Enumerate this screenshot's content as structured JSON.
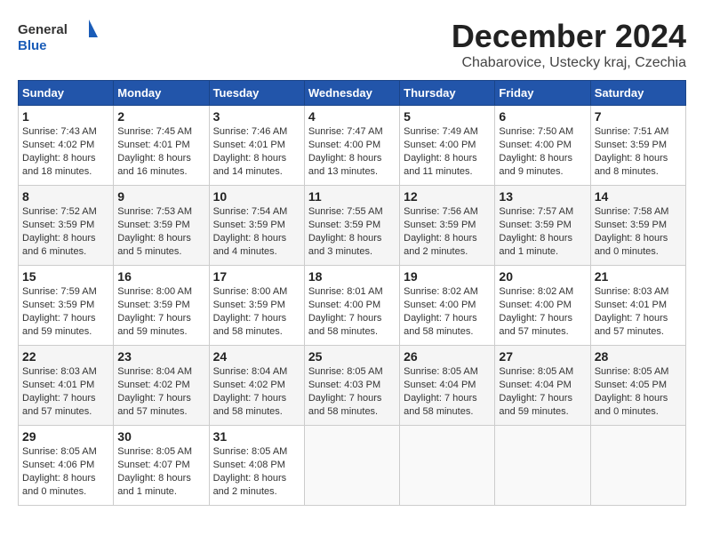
{
  "header": {
    "logo_general": "General",
    "logo_blue": "Blue",
    "month_title": "December 2024",
    "location": "Chabarovice, Ustecky kraj, Czechia"
  },
  "weekdays": [
    "Sunday",
    "Monday",
    "Tuesday",
    "Wednesday",
    "Thursday",
    "Friday",
    "Saturday"
  ],
  "weeks": [
    [
      {
        "day": "1",
        "sunrise": "7:43 AM",
        "sunset": "4:02 PM",
        "daylight": "8 hours and 18 minutes."
      },
      {
        "day": "2",
        "sunrise": "7:45 AM",
        "sunset": "4:01 PM",
        "daylight": "8 hours and 16 minutes."
      },
      {
        "day": "3",
        "sunrise": "7:46 AM",
        "sunset": "4:01 PM",
        "daylight": "8 hours and 14 minutes."
      },
      {
        "day": "4",
        "sunrise": "7:47 AM",
        "sunset": "4:00 PM",
        "daylight": "8 hours and 13 minutes."
      },
      {
        "day": "5",
        "sunrise": "7:49 AM",
        "sunset": "4:00 PM",
        "daylight": "8 hours and 11 minutes."
      },
      {
        "day": "6",
        "sunrise": "7:50 AM",
        "sunset": "4:00 PM",
        "daylight": "8 hours and 9 minutes."
      },
      {
        "day": "7",
        "sunrise": "7:51 AM",
        "sunset": "3:59 PM",
        "daylight": "8 hours and 8 minutes."
      }
    ],
    [
      {
        "day": "8",
        "sunrise": "7:52 AM",
        "sunset": "3:59 PM",
        "daylight": "8 hours and 6 minutes."
      },
      {
        "day": "9",
        "sunrise": "7:53 AM",
        "sunset": "3:59 PM",
        "daylight": "8 hours and 5 minutes."
      },
      {
        "day": "10",
        "sunrise": "7:54 AM",
        "sunset": "3:59 PM",
        "daylight": "8 hours and 4 minutes."
      },
      {
        "day": "11",
        "sunrise": "7:55 AM",
        "sunset": "3:59 PM",
        "daylight": "8 hours and 3 minutes."
      },
      {
        "day": "12",
        "sunrise": "7:56 AM",
        "sunset": "3:59 PM",
        "daylight": "8 hours and 2 minutes."
      },
      {
        "day": "13",
        "sunrise": "7:57 AM",
        "sunset": "3:59 PM",
        "daylight": "8 hours and 1 minute."
      },
      {
        "day": "14",
        "sunrise": "7:58 AM",
        "sunset": "3:59 PM",
        "daylight": "8 hours and 0 minutes."
      }
    ],
    [
      {
        "day": "15",
        "sunrise": "7:59 AM",
        "sunset": "3:59 PM",
        "daylight": "7 hours and 59 minutes."
      },
      {
        "day": "16",
        "sunrise": "8:00 AM",
        "sunset": "3:59 PM",
        "daylight": "7 hours and 59 minutes."
      },
      {
        "day": "17",
        "sunrise": "8:00 AM",
        "sunset": "3:59 PM",
        "daylight": "7 hours and 58 minutes."
      },
      {
        "day": "18",
        "sunrise": "8:01 AM",
        "sunset": "4:00 PM",
        "daylight": "7 hours and 58 minutes."
      },
      {
        "day": "19",
        "sunrise": "8:02 AM",
        "sunset": "4:00 PM",
        "daylight": "7 hours and 58 minutes."
      },
      {
        "day": "20",
        "sunrise": "8:02 AM",
        "sunset": "4:00 PM",
        "daylight": "7 hours and 57 minutes."
      },
      {
        "day": "21",
        "sunrise": "8:03 AM",
        "sunset": "4:01 PM",
        "daylight": "7 hours and 57 minutes."
      }
    ],
    [
      {
        "day": "22",
        "sunrise": "8:03 AM",
        "sunset": "4:01 PM",
        "daylight": "7 hours and 57 minutes."
      },
      {
        "day": "23",
        "sunrise": "8:04 AM",
        "sunset": "4:02 PM",
        "daylight": "7 hours and 57 minutes."
      },
      {
        "day": "24",
        "sunrise": "8:04 AM",
        "sunset": "4:02 PM",
        "daylight": "7 hours and 58 minutes."
      },
      {
        "day": "25",
        "sunrise": "8:05 AM",
        "sunset": "4:03 PM",
        "daylight": "7 hours and 58 minutes."
      },
      {
        "day": "26",
        "sunrise": "8:05 AM",
        "sunset": "4:04 PM",
        "daylight": "7 hours and 58 minutes."
      },
      {
        "day": "27",
        "sunrise": "8:05 AM",
        "sunset": "4:04 PM",
        "daylight": "7 hours and 59 minutes."
      },
      {
        "day": "28",
        "sunrise": "8:05 AM",
        "sunset": "4:05 PM",
        "daylight": "8 hours and 0 minutes."
      }
    ],
    [
      {
        "day": "29",
        "sunrise": "8:05 AM",
        "sunset": "4:06 PM",
        "daylight": "8 hours and 0 minutes."
      },
      {
        "day": "30",
        "sunrise": "8:05 AM",
        "sunset": "4:07 PM",
        "daylight": "8 hours and 1 minute."
      },
      {
        "day": "31",
        "sunrise": "8:05 AM",
        "sunset": "4:08 PM",
        "daylight": "8 hours and 2 minutes."
      },
      null,
      null,
      null,
      null
    ]
  ]
}
